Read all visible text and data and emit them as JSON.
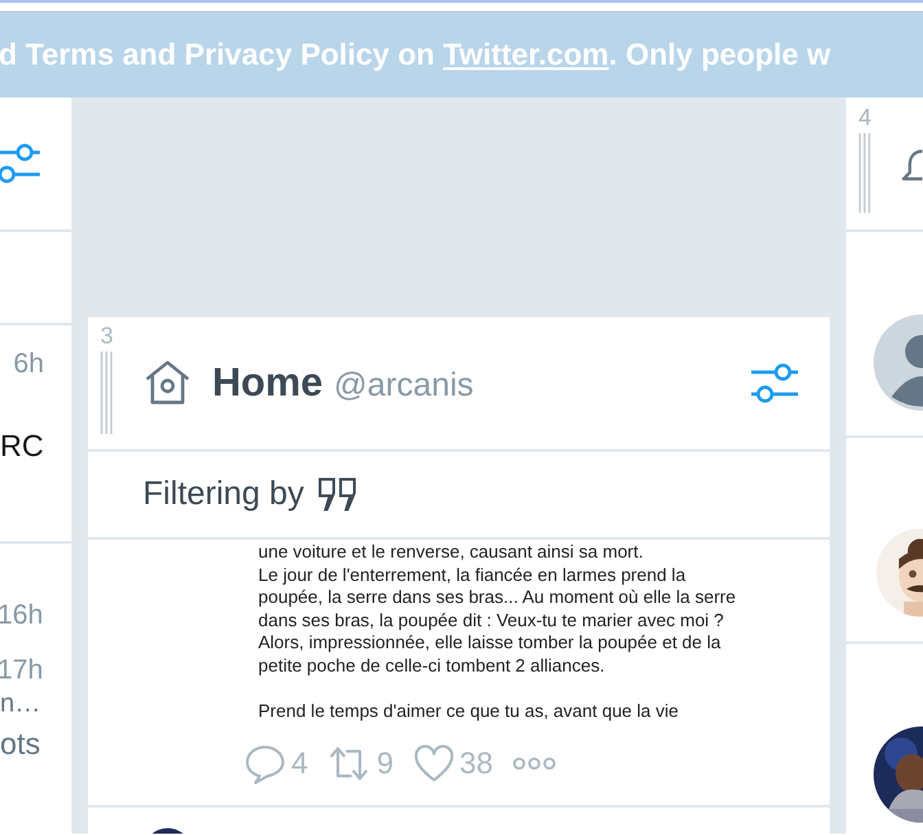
{
  "banner": {
    "text_before": "d Terms and Privacy Policy on ",
    "link": "Twitter.com",
    "text_after": ". Only people w"
  },
  "left_column": {
    "sections": [
      {
        "lines": [
          {
            "kind": "time",
            "text": "6h"
          },
          {
            "kind": "name",
            "text": "RC"
          }
        ]
      },
      {
        "lines": [
          {
            "kind": "time",
            "text": "16h"
          },
          {
            "kind": "time",
            "text": "17h"
          },
          {
            "kind": "snippet",
            "text": "n…"
          },
          {
            "kind": "stat",
            "text": "ots"
          }
        ]
      }
    ]
  },
  "home_column": {
    "number": "3",
    "title": "Home",
    "account": "@arcanis",
    "filter_label": "Filtering by",
    "tweet": {
      "image_paragraphs": [
        [
          "une voiture et le renverse, causant ainsi sa mort.",
          "Le jour de l'enterrement, la fiancée en larmes prend la",
          "poupée, la serre dans ses bras... Au moment où elle la serre",
          "dans ses bras, la poupée dit : Veux-tu te marier avec moi ?",
          "Alors, impressionnée, elle laisse tomber la poupée et de la",
          "petite poche de celle-ci tombent 2 alliances."
        ],
        [
          "Prend le temps d'aimer ce que tu as, avant que la vie"
        ]
      ],
      "actions": [
        {
          "kind": "reply",
          "count": "4"
        },
        {
          "kind": "retweet",
          "count": "9"
        },
        {
          "kind": "like",
          "count": "38"
        },
        {
          "kind": "more"
        }
      ]
    },
    "next_tweet": {
      "avatar": {
        "kind": "picture"
      }
    }
  },
  "right_column": {
    "number": "4",
    "avatars": [
      {
        "kind": "default"
      },
      {
        "kind": "picture"
      },
      {
        "kind": "picture"
      }
    ]
  }
}
